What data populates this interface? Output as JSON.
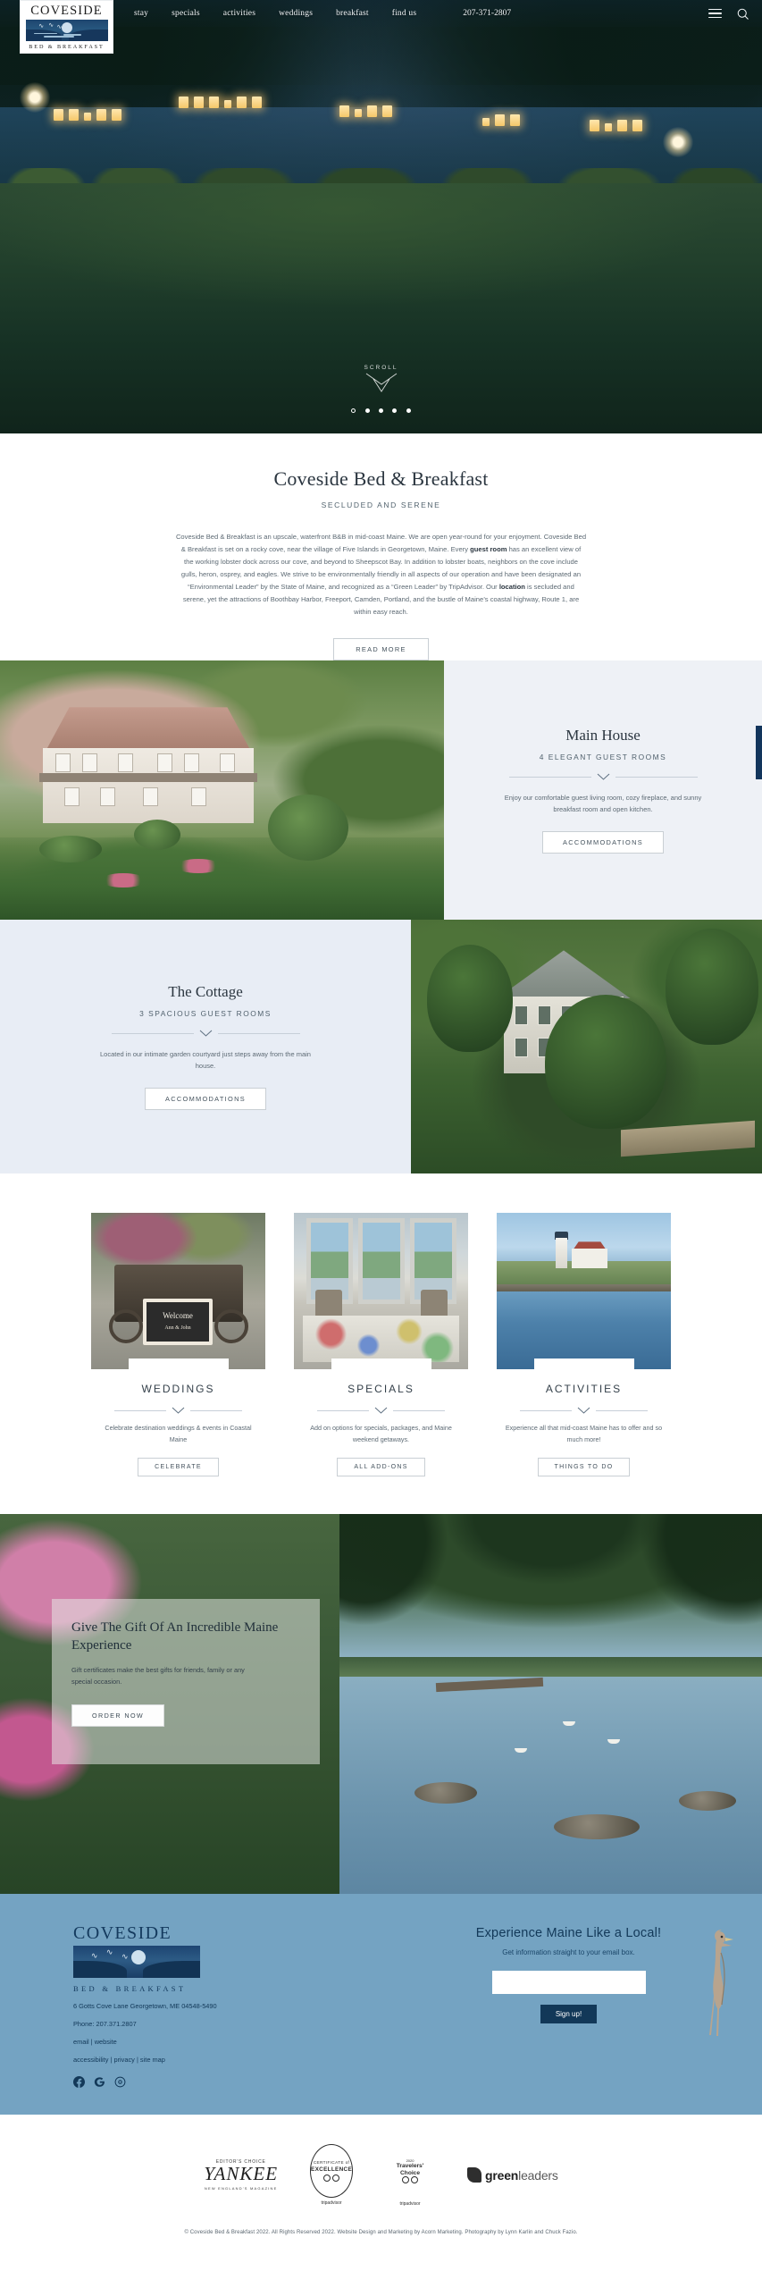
{
  "nav": {
    "brand_word": "COVESIDE",
    "brand_sub": "BED & BREAKFAST",
    "links": [
      {
        "label": "stay"
      },
      {
        "label": "specials"
      },
      {
        "label": "activities"
      },
      {
        "label": "weddings"
      },
      {
        "label": "breakfast"
      },
      {
        "label": "find us"
      }
    ],
    "phone": "207-371-2807",
    "menu_icon": "hamburger-icon",
    "search_icon": "search-icon"
  },
  "hero": {
    "scroll_label": "SCROLL",
    "slide_count": 5,
    "active_slide": 1
  },
  "intro": {
    "title": "Coveside Bed & Breakfast",
    "kicker": "SECLUDED AND SERENE",
    "body_1": "Coveside Bed & Breakfast is an upscale, waterfront B&B in mid-coast Maine. We are open year-round for your enjoyment. Coveside Bed & Breakfast is set on a rocky cove, near the village of Five Islands in Georgetown, Maine. Every ",
    "body_bold_1": "guest room",
    "body_2": " has an excellent view of the working lobster dock across our cove, and beyond to Sheepscot Bay. In addition to lobster boats, neighbors on the cove include gulls, heron, osprey, and eagles. We strive to be environmentally friendly in all aspects of our operation and have been designated an “Environmental Leader” by the State of Maine, and recognized as a “Green Leader” by TripAdvisor. Our ",
    "body_bold_2": "location",
    "body_3": " is secluded and serene, yet the attractions of Boothbay Harbor, Freeport, Camden, Portland, and the bustle of Maine’s coastal highway, Route 1, are within easy reach.",
    "read_more": "READ MORE"
  },
  "main_house": {
    "title": "Main House",
    "sub": "4 ELEGANT GUEST ROOMS",
    "body": "Enjoy our comfortable guest living room, cozy fireplace, and sunny breakfast room and open kitchen.",
    "button": "ACCOMMODATIONS"
  },
  "cottage": {
    "title": "The Cottage",
    "sub": "3 SPACIOUS GUEST ROOMS",
    "body": "Located in our intimate garden courtyard just steps away from the main house.",
    "button": "ACCOMMODATIONS"
  },
  "cards": [
    {
      "title": "WEDDINGS",
      "body": "Celebrate destination weddings & events in Coastal Maine",
      "button": "CELEBRATE",
      "sign_top": "Welcome",
      "sign_bottom": "Ann & John"
    },
    {
      "title": "SPECIALS",
      "body": "Add on options for specials, packages, and Maine weekend getaways.",
      "button": "ALL ADD-ONS"
    },
    {
      "title": "ACTIVITIES",
      "body": "Experience all that mid-coast Maine has to offer and so much more!",
      "button": "THINGS TO DO"
    }
  ],
  "gift": {
    "title": "Give The Gift Of An Incredible Maine Experience",
    "body": "Gift certificates make the best gifts for friends, family or any special occasion.",
    "button": "ORDER NOW"
  },
  "footer": {
    "brand_word": "COVESIDE",
    "brand_sub": "BED & BREAKFAST",
    "address": "6 Gotts Cove Lane Georgetown, ME 04548-5490",
    "phone": "Phone: 207.371.2807",
    "links_row_1": [
      "email",
      "website"
    ],
    "links_row_2": [
      "accessibility",
      "privacy",
      "site map"
    ],
    "social": [
      "facebook-icon",
      "google-icon",
      "tripadvisor-icon"
    ],
    "newsletter": {
      "heading": "Experience Maine Like a Local!",
      "sub": "Get information straight to your email box.",
      "input_value": "",
      "input_placeholder": "",
      "button": "Sign up!"
    },
    "badges": [
      {
        "name": "yankee-magazine-badge",
        "top": "EDITOR'S CHOICE",
        "main": "YANKEE",
        "sub": "NEW ENGLAND'S MAGAZINE"
      },
      {
        "name": "tripadvisor-certificate-badge",
        "line1": "CERTIFICATE of",
        "line2": "EXCELLENCE",
        "brand": "tripadvisor"
      },
      {
        "name": "tripadvisor-travelers-choice-badge",
        "year": "2020",
        "line1": "Travelers'",
        "line2": "Choice",
        "brand": "tripadvisor"
      },
      {
        "name": "greenleaders-badge",
        "bold": "green",
        "light": "leaders"
      }
    ],
    "copyright": "© Coveside Bed & Breakfast 2022. All Rights Reserved 2022. Website Design and Marketing by Acorn Marketing. Photography by Lynn Karlin and Chuck Fazio."
  },
  "colors": {
    "footer_bg": "#74a3c2",
    "navy": "#123858",
    "pale_panel": "#eef1f6"
  }
}
